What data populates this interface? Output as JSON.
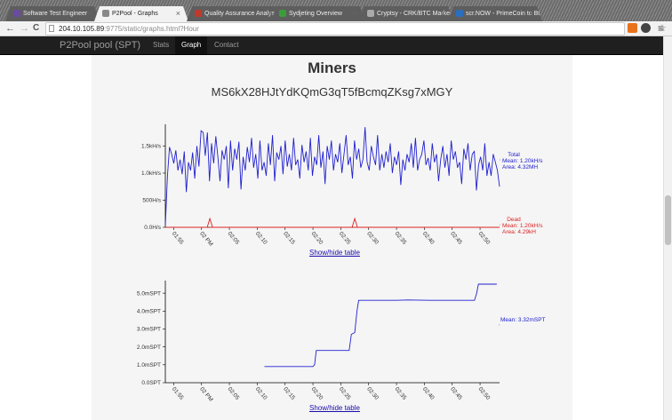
{
  "browser": {
    "tabs": [
      {
        "title": "Software Test Engineer",
        "active": false,
        "favicon_color": "#6b4aa3"
      },
      {
        "title": "P2Pool - Graphs",
        "active": true,
        "favicon_color": "#888888"
      },
      {
        "title": "Quality Assurance Analyst",
        "active": false,
        "favicon_color": "#c0392b"
      },
      {
        "title": "Sydjeting Overview",
        "active": false,
        "favicon_color": "#3a9d3a"
      },
      {
        "title": "Cryptsy - CRK/BTC Market",
        "active": false,
        "favicon_color": "#aaaaaa"
      },
      {
        "title": "scr.NOW - PrimeCoin to Btc",
        "active": false,
        "favicon_color": "#2a6fbf"
      }
    ],
    "url_host": "204.10.105.89",
    "url_rest": ":9775/static/graphs.html?Hour",
    "back_icon": "←",
    "forward_icon": "→",
    "reload_icon": "C",
    "menu_icon": "≡",
    "star_icon": "☆"
  },
  "navbar": {
    "brand": "P2Pool pool (SPT)",
    "links": [
      "Stats",
      "Graph",
      "Contact"
    ],
    "active_link": "Graph"
  },
  "page": {
    "heading": "Miners",
    "address": "MS6kX28HJtYdKQmG3qT5fBcmqZKsg7xMGY",
    "show_hide_label": "Show/hide table"
  },
  "chart_data": [
    {
      "type": "line",
      "title": "",
      "y_ticks": [
        "0.0H/s",
        "500H/s",
        "1.0kH/s",
        "1.5kH/s"
      ],
      "y_tick_values": [
        0,
        500,
        1000,
        1500
      ],
      "ylim": [
        0,
        1900
      ],
      "x_ticks": [
        "01:55",
        "02 PM",
        "02:05",
        "02:10",
        "02:15",
        "02:20",
        "02:25",
        "02:30",
        "02:35",
        "02:40",
        "02:45",
        "02:50"
      ],
      "x_range_minutes": [
        -1.5,
        58.5
      ],
      "grid": false,
      "series": [
        {
          "name": "Total",
          "color": "#2020d0",
          "annotations": [
            "Total",
            "Mean: 1.20kH/s",
            "Area: 4.32MH"
          ],
          "values": [
            40,
            950,
            1480,
            1350,
            1180,
            1420,
            1050,
            1250,
            980,
            1400,
            650,
            1200,
            1050,
            1380,
            900,
            1500,
            1120,
            1780,
            1750,
            1320,
            1750,
            850,
            1550,
            1180,
            1680,
            1300,
            850,
            1420,
            1250,
            1500,
            720,
            1600,
            1050,
            1450,
            1250,
            1580,
            700,
            1300,
            1050,
            1480,
            1200,
            1650,
            1100,
            1350,
            900,
            1600,
            1050,
            1200,
            950,
            1550,
            1150,
            1700,
            850,
            1380,
            1250,
            1500,
            980,
            1600,
            1120,
            1350,
            1050,
            1650,
            1150,
            1250,
            900,
            1520,
            1200,
            1400,
            1050,
            1650,
            950,
            1300,
            1150,
            1700,
            1100,
            1400,
            800,
            1500,
            1250,
            1600,
            1050,
            1350,
            1200,
            1550,
            1000,
            1350,
            1700,
            1150,
            1300,
            900,
            1600,
            1250,
            1450,
            1100,
            1250,
            1850,
            1200,
            1050,
            1500,
            1300,
            1150,
            1700,
            1050,
            1350,
            1100,
            1400,
            1200,
            1550,
            1000,
            1300,
            1150,
            1400,
            780,
            1250,
            1050,
            1350,
            1200,
            1550,
            1100,
            1650,
            1050,
            1250,
            1350,
            1600,
            1150,
            1280,
            1050,
            1550,
            1200,
            1350,
            850,
            1250,
            1500,
            1100,
            1350,
            950,
            1600,
            1250,
            1400,
            1100,
            1200,
            800,
            1450,
            1250,
            1550,
            1050,
            1350,
            1400,
            680,
            1150,
            1300,
            1050,
            1550,
            950,
            1200,
            950,
            1350,
            1200,
            1050,
            750
          ]
        },
        {
          "name": "Dead",
          "color": "#dd2222",
          "annotations": [
            "Dead",
            "Mean: 1.20kH/s",
            "Area: 4.29kH"
          ],
          "values": [
            0,
            0,
            0,
            0,
            0,
            0,
            0,
            0,
            0,
            0,
            0,
            0,
            0,
            0,
            0,
            0,
            0,
            0,
            0,
            0,
            0,
            0,
            0,
            0,
            0,
            0,
            0,
            0,
            0,
            0,
            0,
            0,
            0,
            0,
            0,
            0,
            0,
            0,
            0,
            0,
            0,
            0,
            0,
            0,
            0,
            0,
            0,
            0,
            0,
            0,
            0,
            0,
            0,
            0,
            0,
            0,
            0,
            0,
            0,
            0,
            0,
            0,
            0,
            0,
            0,
            0,
            0,
            0,
            0,
            0,
            0,
            0,
            0,
            0,
            0,
            0,
            0,
            0,
            0,
            0,
            0,
            0,
            0,
            0,
            0,
            0,
            0,
            0,
            0,
            0,
            0,
            0,
            0,
            0,
            0,
            0,
            0,
            0,
            0,
            0,
            0,
            0,
            0,
            0,
            0,
            0,
            0,
            0,
            0,
            0,
            0,
            0,
            0,
            0,
            0,
            0,
            0,
            0,
            0,
            0,
            0,
            0,
            0,
            0,
            0,
            0,
            0,
            0,
            0,
            0,
            0,
            0,
            0,
            0,
            0,
            0,
            0,
            0,
            0,
            0,
            0,
            0,
            0,
            0,
            0,
            0,
            0,
            0,
            0,
            0,
            0,
            0,
            0,
            0,
            0,
            0,
            0,
            0,
            0,
            0,
            0,
            0,
            0
          ],
          "spikes": [
            {
              "minute": 6.5,
              "value": 160
            },
            {
              "minute": 32.5,
              "value": 160
            }
          ]
        }
      ]
    },
    {
      "type": "line",
      "title": "",
      "y_ticks": [
        "0.0SPT",
        "1.0mSPT",
        "2.0mSPT",
        "3.0mSPT",
        "4.0mSPT",
        "5.0mSPT"
      ],
      "y_tick_values": [
        0,
        1,
        2,
        3,
        4,
        5
      ],
      "ylim": [
        0,
        5.7
      ],
      "x_ticks": [
        "01:55",
        "02 PM",
        "02:05",
        "02:10",
        "02:15",
        "02:20",
        "02:25",
        "02:30",
        "02:35",
        "02:40",
        "02:45",
        "02:50"
      ],
      "x_range_minutes": [
        -1.5,
        58.5
      ],
      "grid": false,
      "series": [
        {
          "name": "",
          "color": "#2020d0",
          "annotations": [
            "Mean: 3.32mSPT"
          ],
          "points": [
            [
              16.3,
              0.9
            ],
            [
              25.0,
              0.9
            ],
            [
              25.3,
              1.0
            ],
            [
              25.6,
              1.8
            ],
            [
              31.5,
              1.8
            ],
            [
              31.9,
              2.7
            ],
            [
              32.5,
              2.8
            ],
            [
              32.9,
              4.0
            ],
            [
              33.2,
              4.6
            ],
            [
              40,
              4.6
            ],
            [
              42,
              4.62
            ],
            [
              46,
              4.6
            ],
            [
              54,
              4.6
            ],
            [
              54.4,
              5.0
            ],
            [
              54.7,
              5.5
            ],
            [
              58.0,
              5.5
            ]
          ]
        }
      ]
    }
  ]
}
